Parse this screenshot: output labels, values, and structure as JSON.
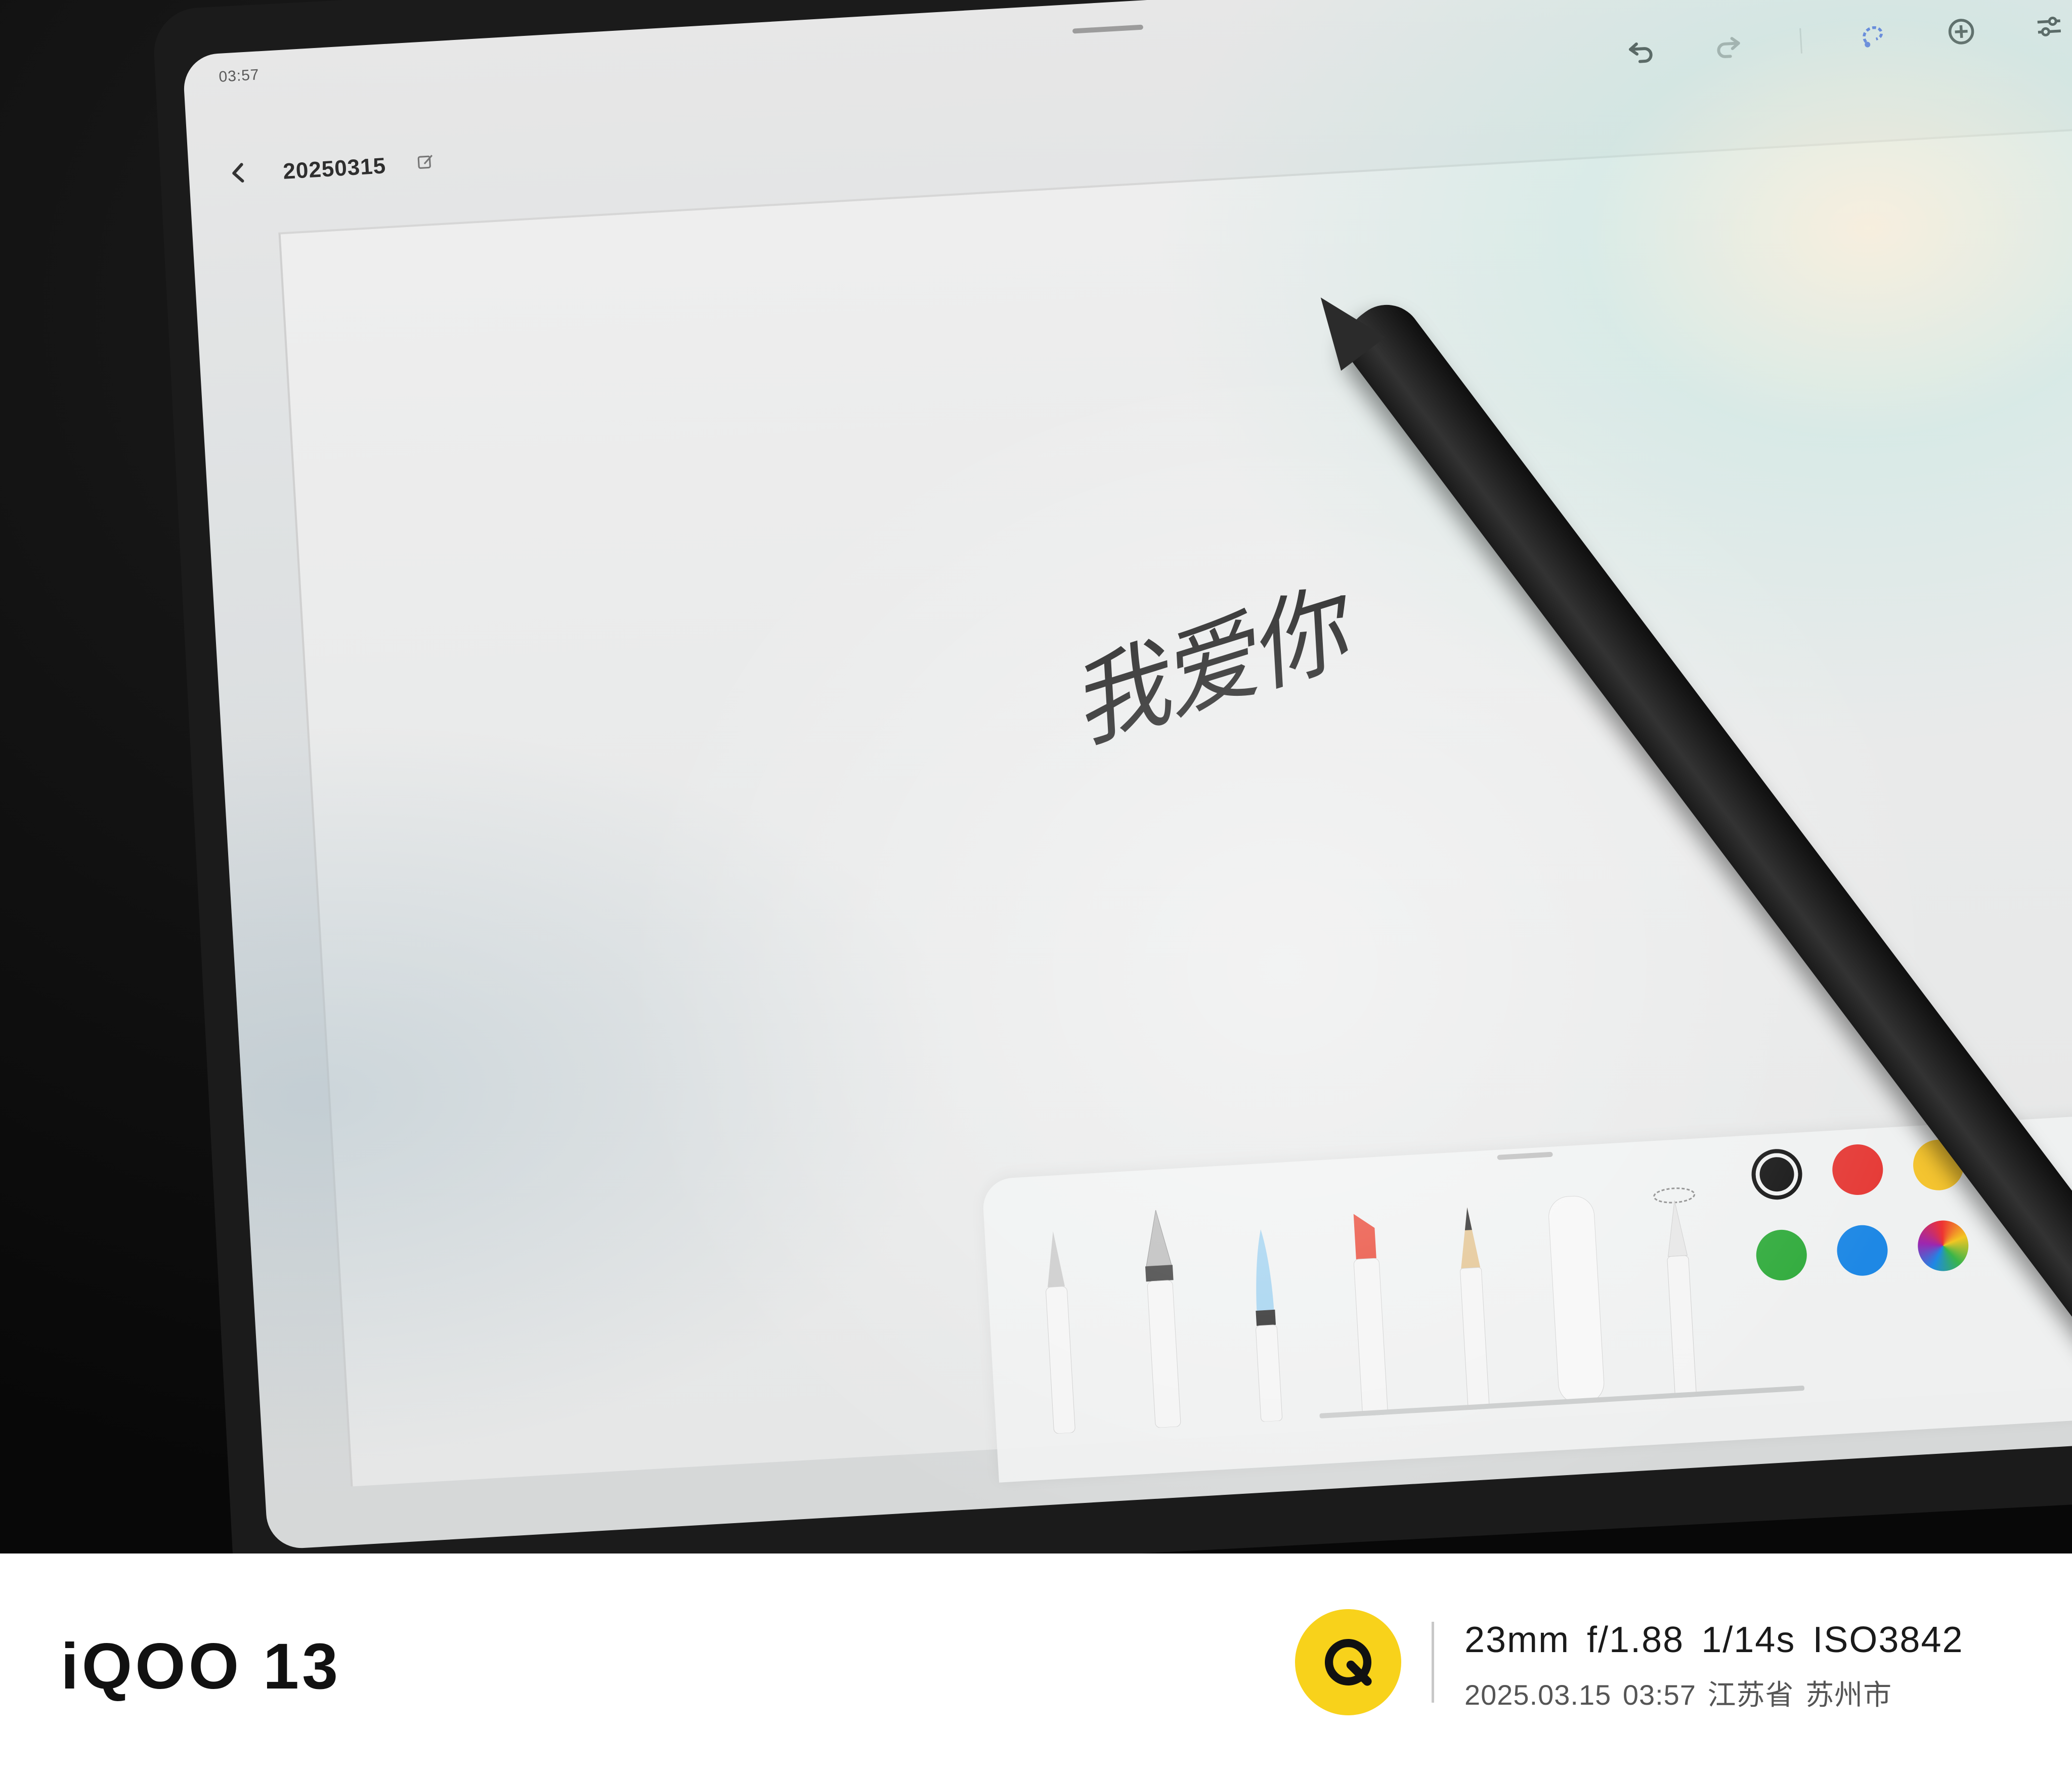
{
  "status": {
    "time": "03:57"
  },
  "header": {
    "title": "20250315",
    "back_icon": "chevron-left-icon",
    "edit_icon": "edit-title-icon"
  },
  "toolbar": {
    "icons": [
      "undo-icon",
      "redo-icon",
      "lasso-select-icon",
      "add-icon",
      "settings-sliders-icon"
    ]
  },
  "canvas": {
    "handwriting": "我爱你"
  },
  "pen_panel": {
    "tools": [
      "ballpoint-pen",
      "fountain-pen",
      "brush-pen",
      "highlighter",
      "pencil",
      "eraser",
      "lasso-tool"
    ],
    "colors": [
      {
        "name": "black",
        "hex": "#111111",
        "selected": true
      },
      {
        "name": "red",
        "hex": "#e53935",
        "selected": false
      },
      {
        "name": "yellow",
        "hex": "#f4c430",
        "selected": false
      },
      {
        "name": "green",
        "hex": "#2eaa3a",
        "selected": false
      },
      {
        "name": "blue",
        "hex": "#1e88e5",
        "selected": false
      },
      {
        "name": "custom-color-wheel",
        "hex": "",
        "selected": false
      }
    ],
    "side_icons": [
      "pen-settings-icon",
      "gear-icon"
    ]
  },
  "watermark": {
    "brand": "iQOO 13",
    "exif": "23mm f/1.88 1/14s ISO3842",
    "datetime": "2025.03.15 03:57",
    "location": "江苏省 苏州市"
  }
}
